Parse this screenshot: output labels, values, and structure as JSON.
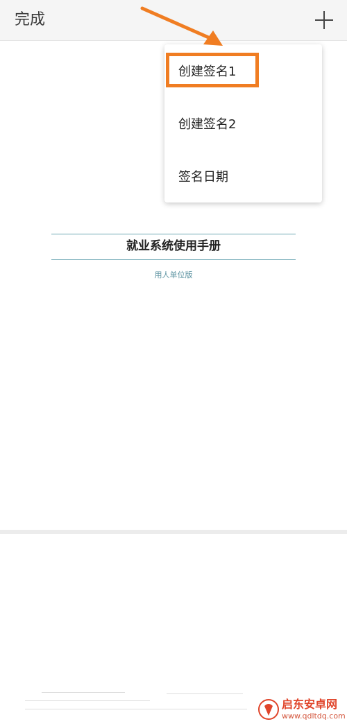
{
  "toolbar": {
    "done_label": "完成",
    "add_icon": "plus-icon"
  },
  "menu": {
    "items": [
      {
        "label": "创建签名1",
        "highlighted": true
      },
      {
        "label": "创建签名2",
        "highlighted": false
      },
      {
        "label": "签名日期",
        "highlighted": false
      }
    ]
  },
  "document": {
    "title": "就业系统使用手册",
    "subtitle": "用人单位版"
  },
  "annotation": {
    "color": "#f07d22",
    "arrow_icon": "arrow-pointer",
    "highlight_target": "创建签名1"
  },
  "watermark": {
    "text": "启东安卓网",
    "url": "www.qdltdq.com",
    "color": "#e0452b"
  }
}
